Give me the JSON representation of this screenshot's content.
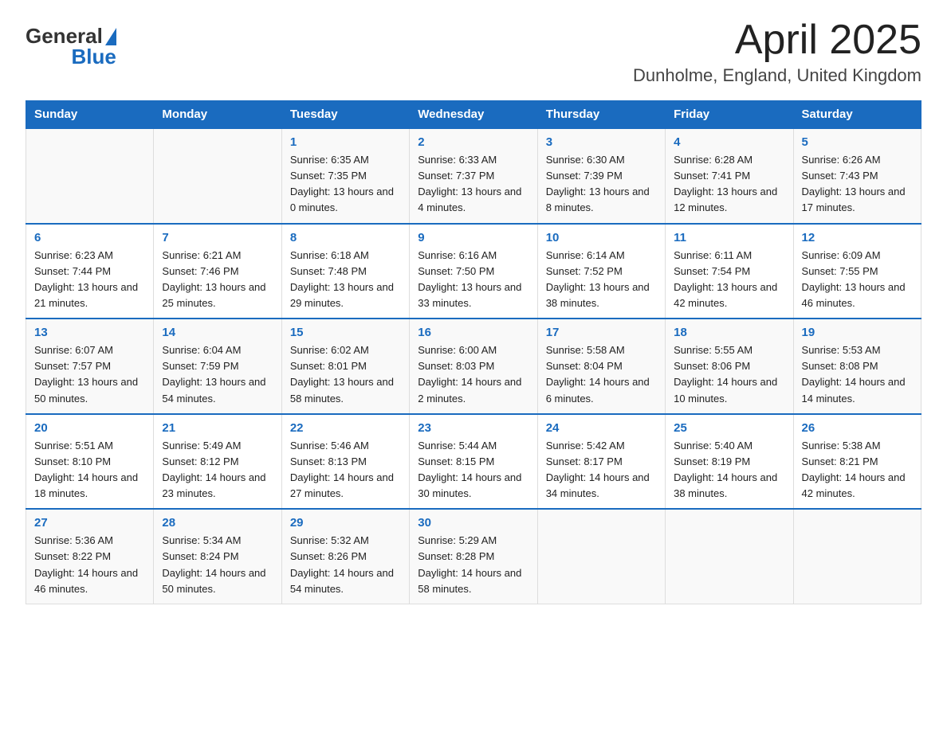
{
  "header": {
    "title": "April 2025",
    "subtitle": "Dunholme, England, United Kingdom",
    "logo_general": "General",
    "logo_blue": "Blue"
  },
  "days_of_week": [
    "Sunday",
    "Monday",
    "Tuesday",
    "Wednesday",
    "Thursday",
    "Friday",
    "Saturday"
  ],
  "weeks": [
    [
      {
        "day": "",
        "sunrise": "",
        "sunset": "",
        "daylight": ""
      },
      {
        "day": "",
        "sunrise": "",
        "sunset": "",
        "daylight": ""
      },
      {
        "day": "1",
        "sunrise": "6:35 AM",
        "sunset": "7:35 PM",
        "daylight": "13 hours and 0 minutes."
      },
      {
        "day": "2",
        "sunrise": "6:33 AM",
        "sunset": "7:37 PM",
        "daylight": "13 hours and 4 minutes."
      },
      {
        "day": "3",
        "sunrise": "6:30 AM",
        "sunset": "7:39 PM",
        "daylight": "13 hours and 8 minutes."
      },
      {
        "day": "4",
        "sunrise": "6:28 AM",
        "sunset": "7:41 PM",
        "daylight": "13 hours and 12 minutes."
      },
      {
        "day": "5",
        "sunrise": "6:26 AM",
        "sunset": "7:43 PM",
        "daylight": "13 hours and 17 minutes."
      }
    ],
    [
      {
        "day": "6",
        "sunrise": "6:23 AM",
        "sunset": "7:44 PM",
        "daylight": "13 hours and 21 minutes."
      },
      {
        "day": "7",
        "sunrise": "6:21 AM",
        "sunset": "7:46 PM",
        "daylight": "13 hours and 25 minutes."
      },
      {
        "day": "8",
        "sunrise": "6:18 AM",
        "sunset": "7:48 PM",
        "daylight": "13 hours and 29 minutes."
      },
      {
        "day": "9",
        "sunrise": "6:16 AM",
        "sunset": "7:50 PM",
        "daylight": "13 hours and 33 minutes."
      },
      {
        "day": "10",
        "sunrise": "6:14 AM",
        "sunset": "7:52 PM",
        "daylight": "13 hours and 38 minutes."
      },
      {
        "day": "11",
        "sunrise": "6:11 AM",
        "sunset": "7:54 PM",
        "daylight": "13 hours and 42 minutes."
      },
      {
        "day": "12",
        "sunrise": "6:09 AM",
        "sunset": "7:55 PM",
        "daylight": "13 hours and 46 minutes."
      }
    ],
    [
      {
        "day": "13",
        "sunrise": "6:07 AM",
        "sunset": "7:57 PM",
        "daylight": "13 hours and 50 minutes."
      },
      {
        "day": "14",
        "sunrise": "6:04 AM",
        "sunset": "7:59 PM",
        "daylight": "13 hours and 54 minutes."
      },
      {
        "day": "15",
        "sunrise": "6:02 AM",
        "sunset": "8:01 PM",
        "daylight": "13 hours and 58 minutes."
      },
      {
        "day": "16",
        "sunrise": "6:00 AM",
        "sunset": "8:03 PM",
        "daylight": "14 hours and 2 minutes."
      },
      {
        "day": "17",
        "sunrise": "5:58 AM",
        "sunset": "8:04 PM",
        "daylight": "14 hours and 6 minutes."
      },
      {
        "day": "18",
        "sunrise": "5:55 AM",
        "sunset": "8:06 PM",
        "daylight": "14 hours and 10 minutes."
      },
      {
        "day": "19",
        "sunrise": "5:53 AM",
        "sunset": "8:08 PM",
        "daylight": "14 hours and 14 minutes."
      }
    ],
    [
      {
        "day": "20",
        "sunrise": "5:51 AM",
        "sunset": "8:10 PM",
        "daylight": "14 hours and 18 minutes."
      },
      {
        "day": "21",
        "sunrise": "5:49 AM",
        "sunset": "8:12 PM",
        "daylight": "14 hours and 23 minutes."
      },
      {
        "day": "22",
        "sunrise": "5:46 AM",
        "sunset": "8:13 PM",
        "daylight": "14 hours and 27 minutes."
      },
      {
        "day": "23",
        "sunrise": "5:44 AM",
        "sunset": "8:15 PM",
        "daylight": "14 hours and 30 minutes."
      },
      {
        "day": "24",
        "sunrise": "5:42 AM",
        "sunset": "8:17 PM",
        "daylight": "14 hours and 34 minutes."
      },
      {
        "day": "25",
        "sunrise": "5:40 AM",
        "sunset": "8:19 PM",
        "daylight": "14 hours and 38 minutes."
      },
      {
        "day": "26",
        "sunrise": "5:38 AM",
        "sunset": "8:21 PM",
        "daylight": "14 hours and 42 minutes."
      }
    ],
    [
      {
        "day": "27",
        "sunrise": "5:36 AM",
        "sunset": "8:22 PM",
        "daylight": "14 hours and 46 minutes."
      },
      {
        "day": "28",
        "sunrise": "5:34 AM",
        "sunset": "8:24 PM",
        "daylight": "14 hours and 50 minutes."
      },
      {
        "day": "29",
        "sunrise": "5:32 AM",
        "sunset": "8:26 PM",
        "daylight": "14 hours and 54 minutes."
      },
      {
        "day": "30",
        "sunrise": "5:29 AM",
        "sunset": "8:28 PM",
        "daylight": "14 hours and 58 minutes."
      },
      {
        "day": "",
        "sunrise": "",
        "sunset": "",
        "daylight": ""
      },
      {
        "day": "",
        "sunrise": "",
        "sunset": "",
        "daylight": ""
      },
      {
        "day": "",
        "sunrise": "",
        "sunset": "",
        "daylight": ""
      }
    ]
  ]
}
